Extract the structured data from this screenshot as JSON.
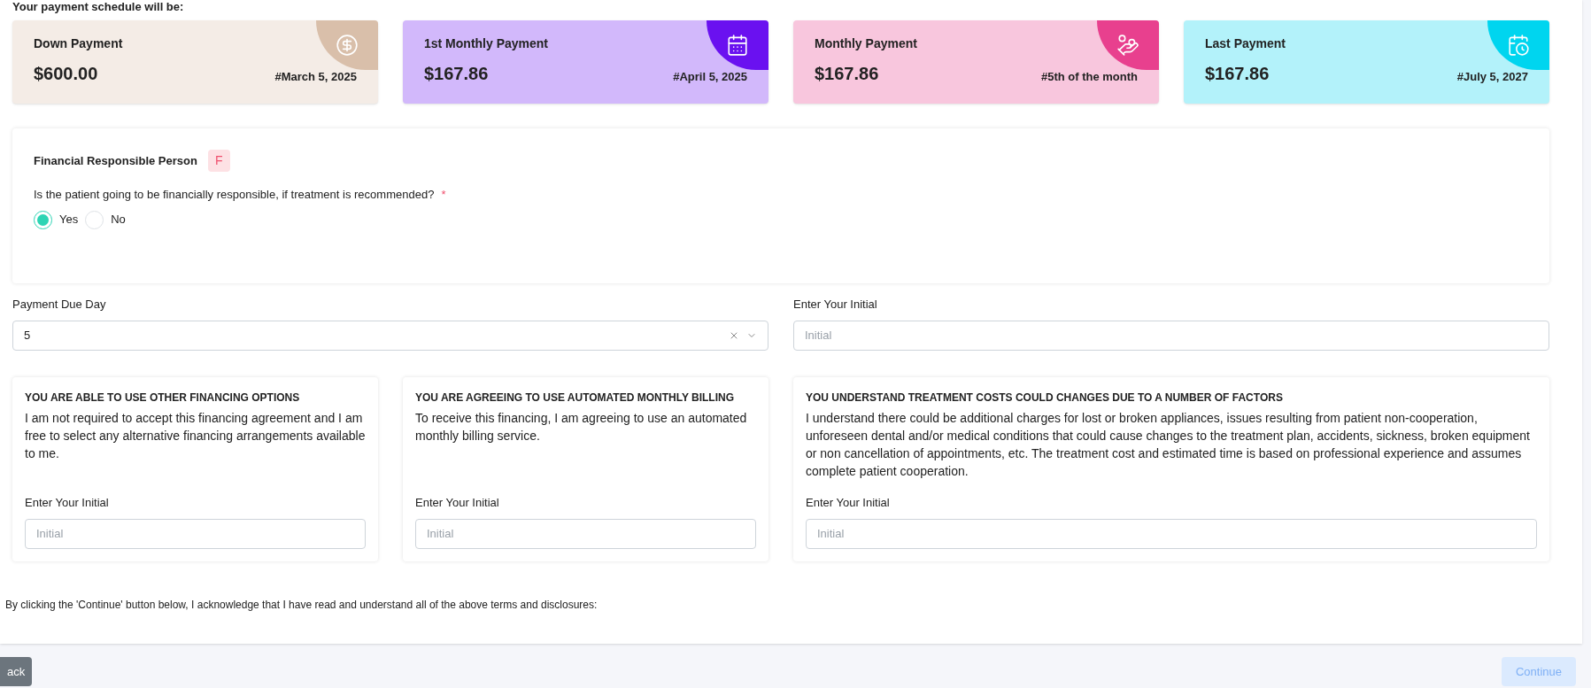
{
  "schedule_heading": "Your payment schedule will be:",
  "payment_cards": [
    {
      "kind": "down",
      "title": "Down Payment",
      "amount": "$600.00",
      "date": "#March 5, 2025",
      "color": "#d9bfaa"
    },
    {
      "kind": "first",
      "title": "1st Monthly Payment",
      "amount": "$167.86",
      "date": "#April 5, 2025",
      "color": "#6a11f0"
    },
    {
      "kind": "monthly",
      "title": "Monthly Payment",
      "amount": "$167.86",
      "date": "#5th of the month",
      "color": "#e8408e"
    },
    {
      "kind": "last",
      "title": "Last Payment",
      "amount": "$167.86",
      "date": "#July 5, 2027",
      "color": "#00d5ef"
    }
  ],
  "responsible": {
    "title": "Financial Responsible Person",
    "badge": "F",
    "question": "Is the patient going to be financially responsible, if treatment is recommended?",
    "required_mark": "*",
    "options": [
      {
        "label": "Yes",
        "selected": true
      },
      {
        "label": "No",
        "selected": false
      }
    ]
  },
  "due_day": {
    "label": "Payment Due Day",
    "value": "5"
  },
  "initial": {
    "label": "Enter Your Initial",
    "placeholder": "Initial"
  },
  "terms": [
    {
      "title": "YOU ARE ABLE TO USE OTHER FINANCING OPTIONS",
      "text": "I am not required to accept this financing agreement and I am free to select any alternative financing arrangements available to me.",
      "initial_label": "Enter Your Initial",
      "placeholder": "Initial"
    },
    {
      "title": "YOU ARE AGREEING TO USE AUTOMATED MONTHLY BILLING",
      "text": "To receive this financing, I am agreeing to use an automated monthly billing service.",
      "initial_label": "Enter Your Initial",
      "placeholder": "Initial"
    },
    {
      "title": "YOU UNDERSTAND TREATMENT COSTS COULD CHANGES DUE TO A NUMBER OF FACTORS",
      "text": "I understand there could be additional charges for lost or broken appliances, issues resulting from patient non-cooperation, unforeseen dental and/or medical conditions that could cause changes to the treatment plan, accidents, sickness, broken equipment or non cancellation of appointments, etc. The treatment cost and estimated time is based on professional experience and assumes complete patient cooperation.",
      "initial_label": "Enter Your Initial",
      "placeholder": "Initial"
    }
  ],
  "acknowledgement": "By clicking the 'Continue' button below, I acknowledge that I have read and understand all of the above terms and disclosures:",
  "buttons": {
    "back": "ack",
    "continue": {
      "label": "Continue",
      "disabled": true
    }
  }
}
